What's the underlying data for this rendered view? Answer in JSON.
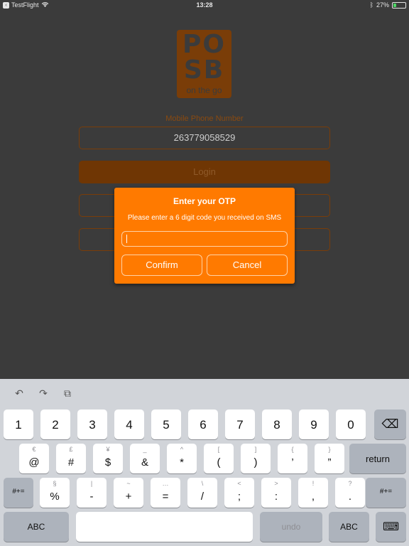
{
  "status_bar": {
    "back_app": "TestFlight",
    "time": "13:28",
    "battery": "27%",
    "battery_level": 0.27
  },
  "logo": {
    "letters_line1": "PO",
    "letters_line2": "SB",
    "tagline": "on the go"
  },
  "login_form": {
    "phone_label": "Mobile Phone Number",
    "phone_value": "263779058529",
    "login_label": "Login"
  },
  "otp_dialog": {
    "title": "Enter your OTP",
    "message": "Please enter a 6 digit code you received on SMS",
    "input_value": "",
    "confirm_label": "Confirm",
    "cancel_label": "Cancel"
  },
  "keyboard": {
    "tools": [
      "↶",
      "↷",
      "⧉"
    ],
    "row1": [
      "1",
      "2",
      "3",
      "4",
      "5",
      "6",
      "7",
      "8",
      "9",
      "0"
    ],
    "row2": [
      {
        "alt": "€",
        "main": "@"
      },
      {
        "alt": "£",
        "main": "#"
      },
      {
        "alt": "¥",
        "main": "$"
      },
      {
        "alt": "_",
        "main": "&"
      },
      {
        "alt": "^",
        "main": "*"
      },
      {
        "alt": "[",
        "main": "("
      },
      {
        "alt": "]",
        "main": ")"
      },
      {
        "alt": "{",
        "main": "’"
      },
      {
        "alt": "}",
        "main": "”"
      }
    ],
    "row3": [
      {
        "alt": "§",
        "main": "%"
      },
      {
        "alt": "|",
        "main": "-"
      },
      {
        "alt": "~",
        "main": "+"
      },
      {
        "alt": "…",
        "main": "="
      },
      {
        "alt": "\\",
        "main": "/"
      },
      {
        "alt": "<",
        "main": ";"
      },
      {
        "alt": ">",
        "main": ":"
      },
      {
        "alt": "!",
        "main": ","
      },
      {
        "alt": "?",
        "main": "."
      }
    ],
    "backspace_icon": "⌫",
    "return_label": "return",
    "shift_label": "#+=",
    "abc_label": "ABC",
    "undo_label": "undo",
    "hide_icon": "⌨"
  }
}
